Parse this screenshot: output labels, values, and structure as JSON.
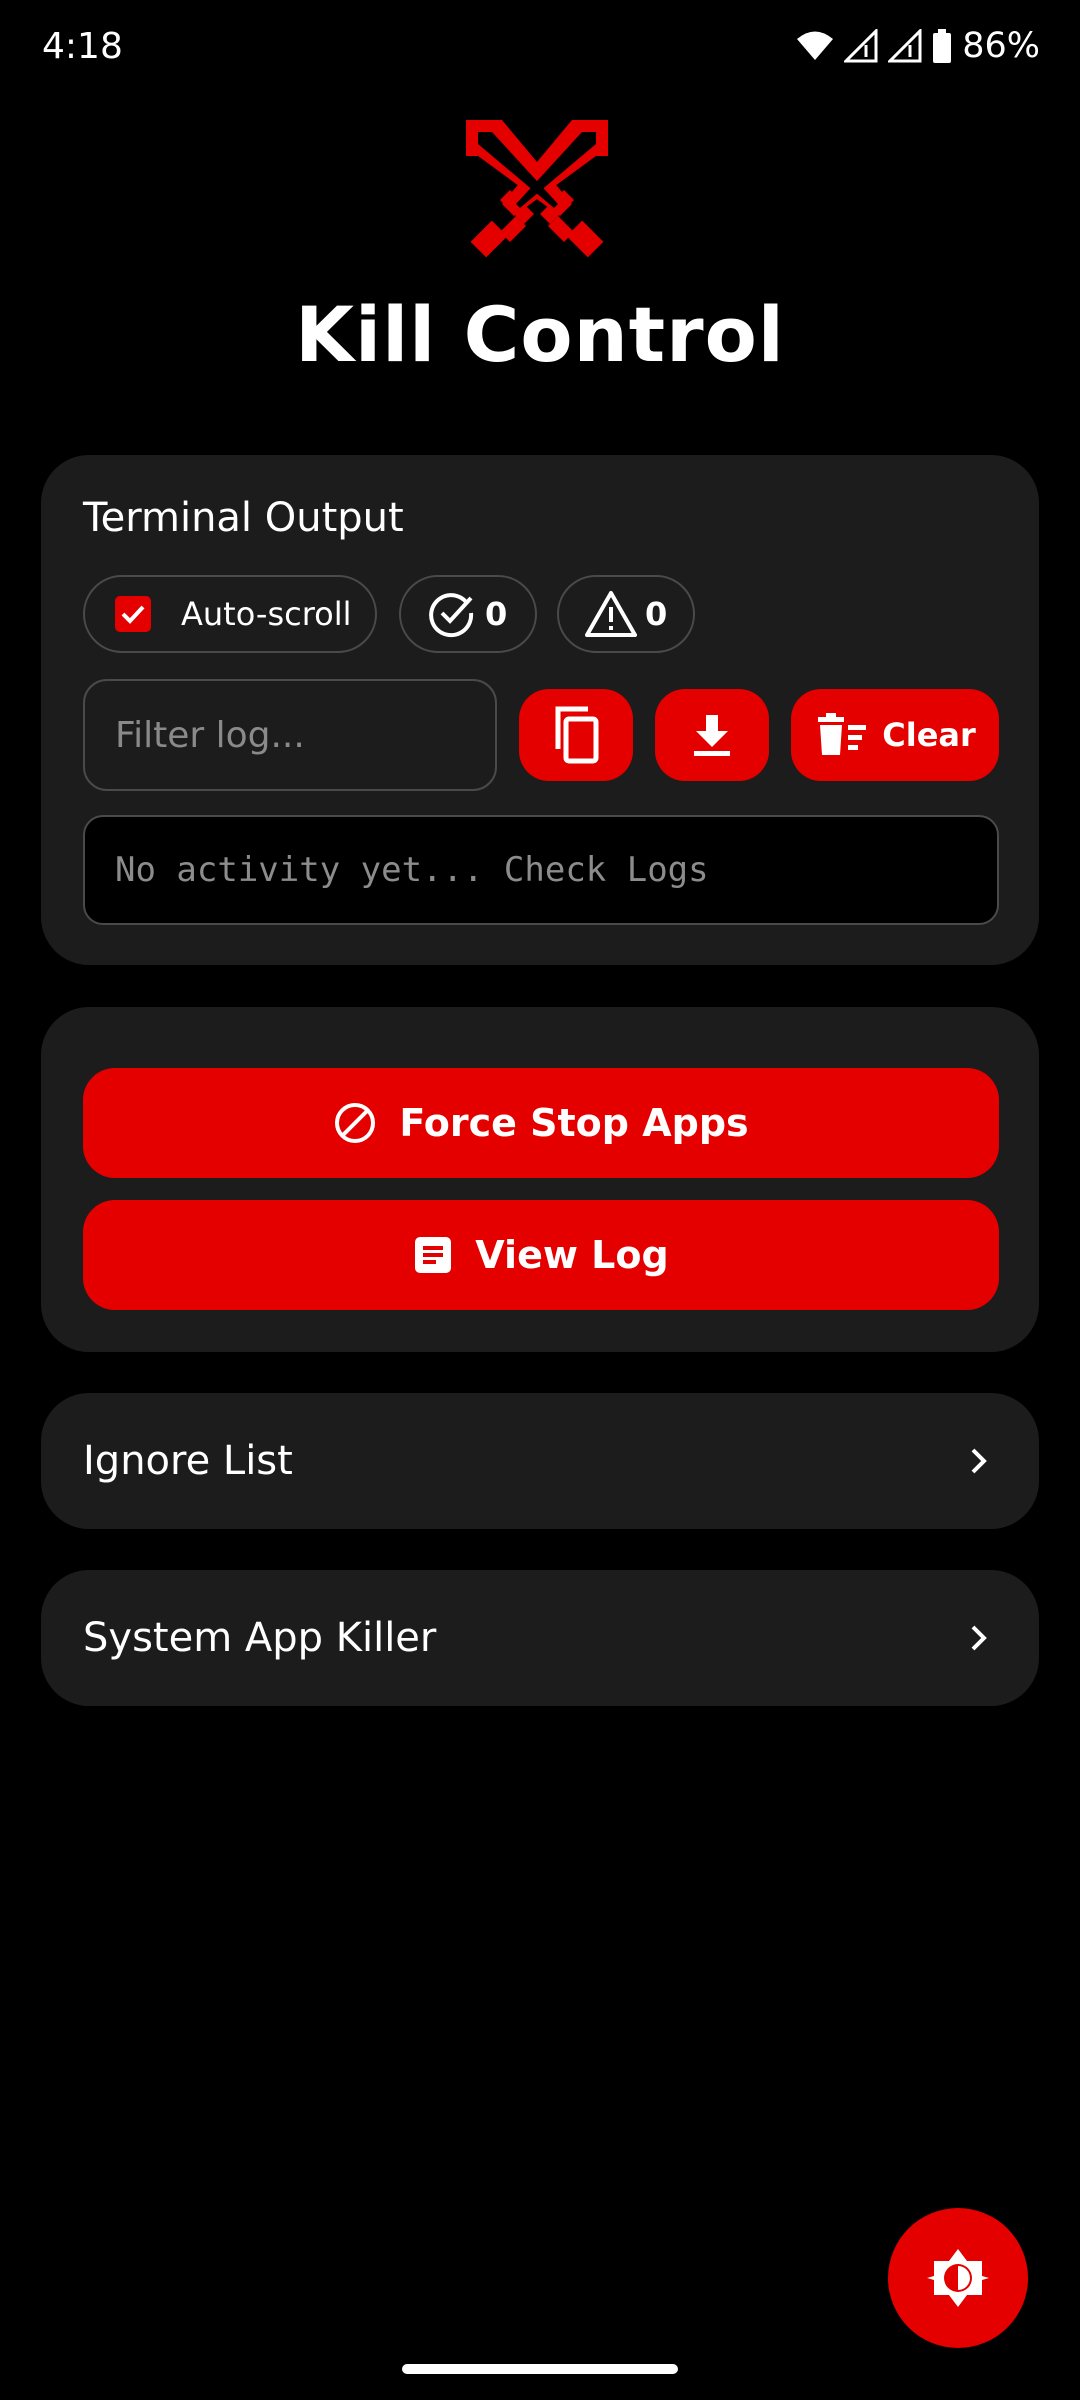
{
  "status_bar": {
    "time": "4:18",
    "battery": "86%"
  },
  "app": {
    "title": "Kill Control"
  },
  "terminal": {
    "title": "Terminal Output",
    "auto_scroll": {
      "label": "Auto-scroll",
      "checked": true
    },
    "success_count": "0",
    "warning_count": "0",
    "filter_placeholder": "Filter log...",
    "clear_label": "Clear",
    "log_text": "No activity yet... Check Logs"
  },
  "actions": {
    "force_stop_label": "Force Stop Apps",
    "view_log_label": "View Log"
  },
  "nav": {
    "ignore_list_label": "Ignore List",
    "system_app_killer_label": "System App Killer"
  },
  "colors": {
    "accent": "#e50000",
    "card_bg": "#1c1c1c",
    "background": "#000000"
  },
  "icons": [
    "crossed-swords-logo",
    "check-icon",
    "check-circle-icon",
    "warning-icon",
    "copy-icon",
    "download-icon",
    "delete-sweep-icon",
    "block-icon",
    "article-icon",
    "chevron-right-icon",
    "brightness-icon"
  ]
}
